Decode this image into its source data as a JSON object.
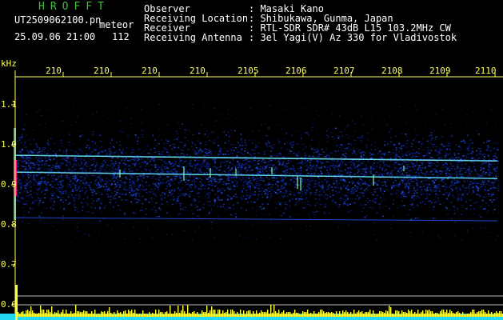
{
  "header": {
    "brand": "HROFFT",
    "filename": "UT2509062100.pn",
    "mode": "meteor",
    "datetime": "25.09.06 21:00",
    "count": "112",
    "fields": [
      {
        "label": "Observer",
        "value": ": Masaki Kano"
      },
      {
        "label": "Receiving Location",
        "value": ": Shibukawa, Gunma, Japan"
      },
      {
        "label": "Receiver",
        "value": ": RTL-SDR SDR# 43dB L15 103.2MHz CW"
      },
      {
        "label": "Receiving Antenna",
        "value": ": 3el Yagi(V) Az 330 for Vladivostok"
      }
    ]
  },
  "xaxis": {
    "ticks": [
      "210",
      "210",
      "210",
      "210",
      "2105",
      "2106",
      "2107",
      "2108",
      "2109",
      "2110"
    ]
  },
  "yaxis": {
    "unit": "kHz",
    "ticks": [
      "1.1",
      "1.0",
      "0.9",
      "0.8",
      "0.7",
      "0.6"
    ]
  },
  "colors": {
    "text": "#ffffff",
    "brand": "#3fbf3f",
    "axis": "#ffff5a",
    "background": "#000000"
  }
}
